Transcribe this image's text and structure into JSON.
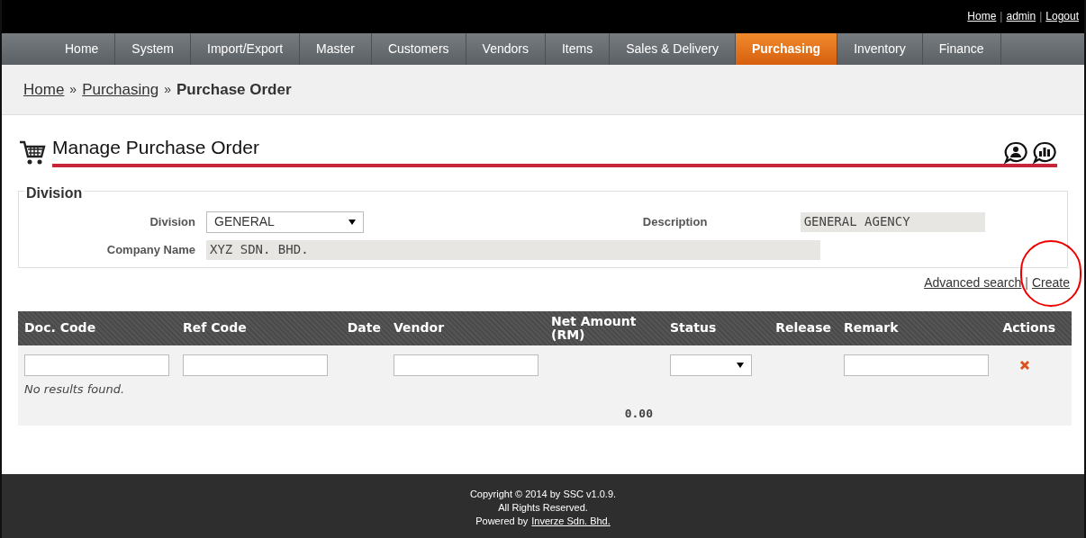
{
  "top_links": [
    {
      "text": "Home",
      "kind": "link"
    },
    {
      "text": "|",
      "kind": "separator"
    },
    {
      "text": "admin",
      "kind": "link"
    },
    {
      "text": "|",
      "kind": "separator"
    },
    {
      "text": "Logout",
      "kind": "link"
    }
  ],
  "nav": [
    {
      "label": "Home",
      "selected": false
    },
    {
      "label": "System",
      "selected": false
    },
    {
      "label": "Import/Export",
      "selected": false
    },
    {
      "label": "Master",
      "selected": false
    },
    {
      "label": "Customers",
      "selected": false
    },
    {
      "label": "Vendors",
      "selected": false
    },
    {
      "label": "Items",
      "selected": false
    },
    {
      "label": "Sales & Delivery",
      "selected": false
    },
    {
      "label": "Purchasing",
      "selected": true
    },
    {
      "label": "Inventory",
      "selected": false
    },
    {
      "label": "Finance",
      "selected": false
    }
  ],
  "breadcrumb": [
    {
      "text": "Home",
      "kind": "link"
    },
    {
      "text": "»",
      "kind": "separator"
    },
    {
      "text": "Purchasing",
      "kind": "link"
    },
    {
      "text": "»",
      "kind": "separator"
    },
    {
      "text": "Purchase Order",
      "kind": "current"
    }
  ],
  "page_title": "Manage Purchase Order",
  "division_panel": {
    "legend": "Division",
    "fields": [
      {
        "label": "Division",
        "kind": "select",
        "value": "GENERAL"
      },
      {
        "label": "Description",
        "kind": "readonly",
        "value": "GENERAL AGENCY"
      },
      {
        "label": "Company Name",
        "kind": "readonly",
        "value": "XYZ SDN. BHD."
      }
    ]
  },
  "links": [
    {
      "text": "Advanced search",
      "kind": "link"
    },
    {
      "text": "|",
      "kind": "separator"
    },
    {
      "text": "Create",
      "kind": "link"
    }
  ],
  "table": {
    "columns": [
      {
        "label": "Doc. Code",
        "kind": "text"
      },
      {
        "label": "Ref Code",
        "kind": "text"
      },
      {
        "label": "Date",
        "kind": "none"
      },
      {
        "label": "Vendor",
        "kind": "text"
      },
      {
        "label": "Net Amount (RM)",
        "kind": "none"
      },
      {
        "label": "Status",
        "kind": "select"
      },
      {
        "label": "Release",
        "kind": "none"
      },
      {
        "label": "Remark",
        "kind": "text"
      },
      {
        "label": "Actions",
        "kind": "clear"
      }
    ],
    "empty_message": "No results found.",
    "total": "0.00"
  },
  "footer": {
    "lines": [
      "Copyright © 2014 by SSC v1.0.9.",
      "All Rights Reserved."
    ],
    "powered_prefix": "Powered by",
    "powered_link": "Inverze Sdn. Bhd."
  }
}
